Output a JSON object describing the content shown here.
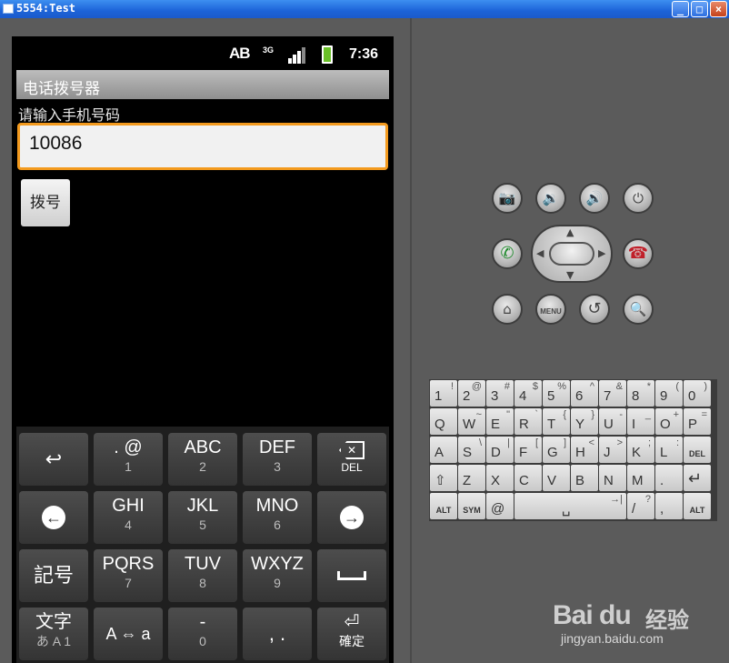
{
  "window": {
    "title": "5554:Test",
    "min": "_",
    "max": "□",
    "close": "×"
  },
  "statusbar": {
    "input_mode": "AB",
    "network": "3G",
    "time": "7:36"
  },
  "app": {
    "title": "电话拨号器",
    "prompt": "请输入手机号码",
    "phone_value": "10086",
    "dial_label": "拨号"
  },
  "keyboard": {
    "rows": [
      [
        {
          "main": "",
          "sub": ""
        },
        {
          "main": ". @",
          "sub": "1"
        },
        {
          "main": "ABC",
          "sub": "2"
        },
        {
          "main": "DEF",
          "sub": "3"
        },
        {
          "main": "",
          "sub": "DEL"
        }
      ],
      [
        {
          "main": "",
          "sub": ""
        },
        {
          "main": "GHI",
          "sub": "4"
        },
        {
          "main": "JKL",
          "sub": "5"
        },
        {
          "main": "MNO",
          "sub": "6"
        },
        {
          "main": "",
          "sub": ""
        }
      ],
      [
        {
          "main": "記号",
          "sub": ""
        },
        {
          "main": "PQRS",
          "sub": "7"
        },
        {
          "main": "TUV",
          "sub": "8"
        },
        {
          "main": "WXYZ",
          "sub": "9"
        },
        {
          "main": "",
          "sub": ""
        }
      ],
      [
        {
          "main": "文字",
          "sub": "あ A 1"
        },
        {
          "main": "A ⇔ a",
          "sub": ""
        },
        {
          "main": "-",
          "sub": "0"
        },
        {
          "main": ",  .",
          "sub": ""
        },
        {
          "main": "⏎",
          "sub": "確定"
        }
      ]
    ]
  },
  "hardware_buttons": {
    "menu_label": "MENU"
  },
  "hw_keyboard": {
    "row1": [
      [
        "1",
        "!"
      ],
      [
        "2",
        "@"
      ],
      [
        "3",
        "#"
      ],
      [
        "4",
        "$"
      ],
      [
        "5",
        "%"
      ],
      [
        "6",
        "^"
      ],
      [
        "7",
        "&"
      ],
      [
        "8",
        "*"
      ],
      [
        "9",
        "("
      ],
      [
        "0",
        ")"
      ]
    ],
    "row2": [
      [
        "Q",
        ""
      ],
      [
        "W",
        "~"
      ],
      [
        "E",
        "\""
      ],
      [
        "R",
        "`"
      ],
      [
        "T",
        "{"
      ],
      [
        "Y",
        "}"
      ],
      [
        "U",
        "-"
      ],
      [
        "I",
        "_"
      ],
      [
        "O",
        "+"
      ],
      [
        "P",
        "="
      ]
    ],
    "row3": [
      [
        "A",
        ""
      ],
      [
        "S",
        "\\"
      ],
      [
        "D",
        "|"
      ],
      [
        "F",
        "["
      ],
      [
        "G",
        "]"
      ],
      [
        "H",
        "<"
      ],
      [
        "J",
        ">"
      ],
      [
        "K",
        ";"
      ],
      [
        "L",
        ":"
      ],
      [
        "DEL",
        ""
      ]
    ],
    "row4": [
      [
        "⇧",
        ""
      ],
      [
        "Z",
        ""
      ],
      [
        "X",
        ""
      ],
      [
        "C",
        ""
      ],
      [
        "V",
        ""
      ],
      [
        "B",
        ""
      ],
      [
        "N",
        ""
      ],
      [
        "M",
        ""
      ],
      [
        ".",
        ""
      ],
      [
        "↵",
        ""
      ]
    ],
    "row5": [
      [
        "ALT",
        ""
      ],
      [
        "SYM",
        ""
      ],
      [
        "@",
        ""
      ],
      [
        "␣",
        "→|"
      ],
      [
        "/",
        "?"
      ],
      [
        ",",
        ""
      ],
      [
        "ALT",
        ""
      ]
    ]
  },
  "watermark": {
    "brand": "Bai du",
    "cn": "经验",
    "url": "jingyan.baidu.com"
  }
}
